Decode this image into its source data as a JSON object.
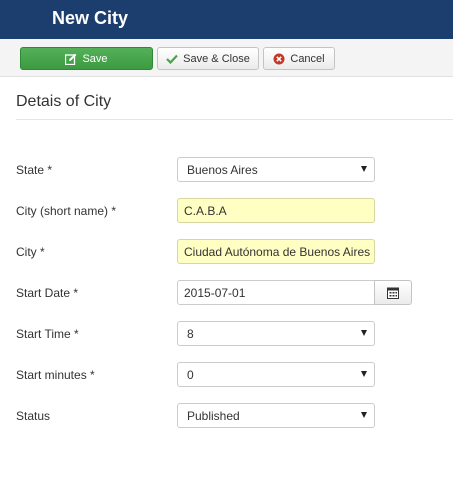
{
  "header": {
    "title": "New City"
  },
  "toolbar": {
    "save_label": "Save",
    "save_close_label": "Save & Close",
    "cancel_label": "Cancel",
    "colors": {
      "save_bg": "#46a546",
      "header_bg": "#1b3e6f",
      "cancel_icon": "#c0392b"
    }
  },
  "section": {
    "title": "Detais of City"
  },
  "form": {
    "state": {
      "label": "State *",
      "value": "Buenos Aires"
    },
    "city_short": {
      "label": "City (short name) *",
      "value": "C.A.B.A"
    },
    "city": {
      "label": "City *",
      "value": "Ciudad Autónoma de Buenos Aires"
    },
    "start_date": {
      "label": "Start Date *",
      "value": "2015-07-01"
    },
    "start_time": {
      "label": "Start Time *",
      "value": "8"
    },
    "start_minutes": {
      "label": "Start minutes *",
      "value": "0"
    },
    "status": {
      "label": "Status",
      "value": "Published"
    }
  }
}
